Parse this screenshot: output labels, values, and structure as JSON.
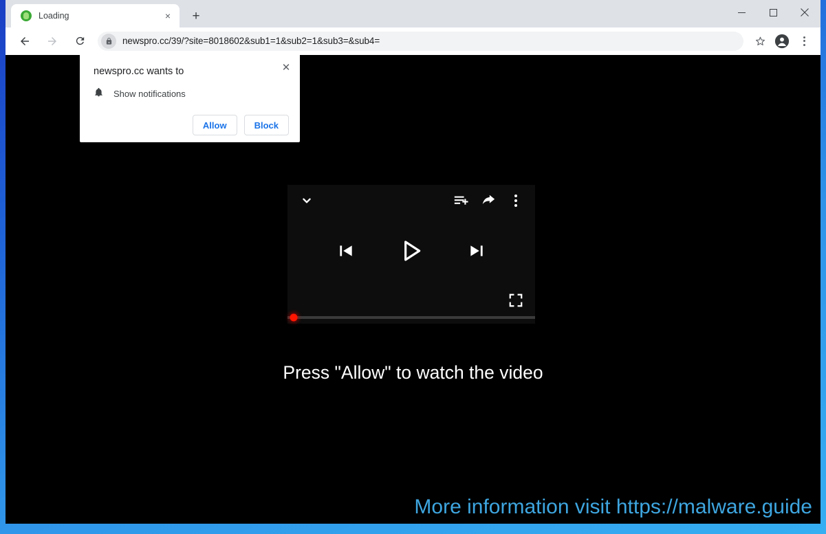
{
  "window": {
    "controls": {
      "minimize": "minimize",
      "maximize": "maximize",
      "close": "close"
    }
  },
  "tabstrip": {
    "tabs": [
      {
        "title": "Loading",
        "favicon": "green-circle-favicon",
        "close_label": "×"
      }
    ],
    "new_tab_label": "+"
  },
  "toolbar": {
    "back_icon": "back-arrow-icon",
    "forward_icon": "forward-arrow-icon",
    "reload_icon": "reload-icon",
    "lock_icon": "lock-icon",
    "url": "newspro.cc/39/?site=8018602&sub1=1&sub2=1&sub3=&sub4=",
    "bookmark_icon": "star-icon",
    "profile_icon": "profile-avatar-icon",
    "menu_icon": "three-dot-menu-icon"
  },
  "permission_bubble": {
    "title": "newspro.cc wants to",
    "close_label": "✕",
    "permission_icon": "bell-icon",
    "permission_label": "Show notifications",
    "allow_label": "Allow",
    "block_label": "Block",
    "link_color": "#1a73e8"
  },
  "player": {
    "collapse_icon": "chevron-down-icon",
    "playlist_icon": "add-to-queue-icon",
    "share_icon": "share-arrow-icon",
    "more_icon": "three-dot-menu-icon",
    "previous_icon": "skip-previous-icon",
    "play_icon": "play-icon",
    "next_icon": "skip-next-icon",
    "fullscreen_icon": "fullscreen-icon",
    "progress_percent": 0,
    "scrubber_color": "#ff1500",
    "track_color": "#3a3a3a"
  },
  "page": {
    "headline": "Press \"Allow\" to watch the video",
    "watermark": "More information visit https://malware.guide",
    "watermark_color": "#3ea6e0",
    "background_color": "#000000"
  }
}
